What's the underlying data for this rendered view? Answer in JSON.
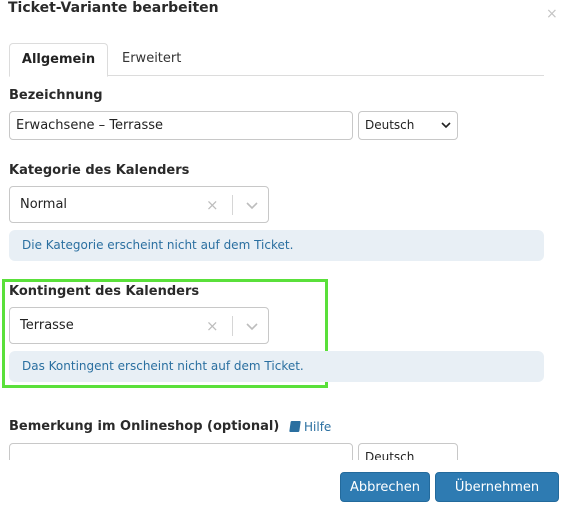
{
  "dialog": {
    "title": "Ticket-Variante bearbeiten",
    "close_glyph": "×"
  },
  "tabs": [
    {
      "label": "Allgemein",
      "active": true
    },
    {
      "label": "Erweitert",
      "active": false
    }
  ],
  "bezeichnung": {
    "label": "Bezeichnung",
    "value": "Erwachsene – Terrasse",
    "language": "Deutsch"
  },
  "kategorie": {
    "label": "Kategorie des Kalenders",
    "value": "Normal",
    "info": "Die Kategorie erscheint nicht auf dem Ticket."
  },
  "kontingent": {
    "label": "Kontingent des Kalenders",
    "value": "Terrasse",
    "info": "Das Kontingent erscheint nicht auf dem Ticket."
  },
  "bemerkung": {
    "label": "Bemerkung im Onlineshop (optional)",
    "help_label": "Hilfe",
    "value": "",
    "language": "Deutsch"
  },
  "footer": {
    "cancel_label": "Abbrechen",
    "apply_label": "Übernehmen"
  },
  "icons": {
    "clear": "×",
    "select_arrow": "⌄",
    "help": "book-icon"
  },
  "colors": {
    "accent": "#2e7bb2",
    "info_bg": "#e8eff5",
    "info_text": "#2a6fa0",
    "highlight": "#5ae03a"
  }
}
